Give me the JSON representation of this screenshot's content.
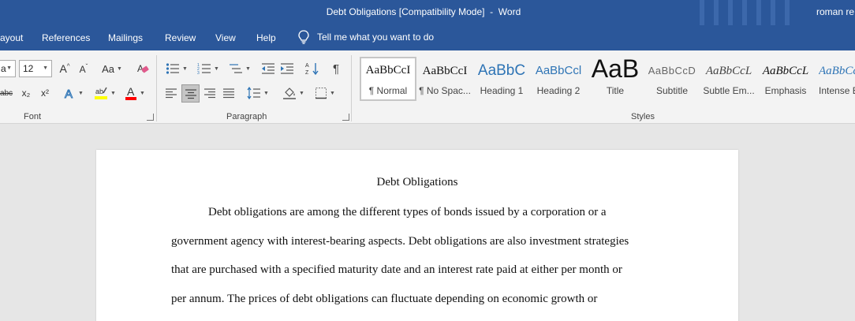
{
  "titlebar": {
    "title": "Debt Obligations [Compatibility Mode]  -  Word",
    "user": "roman re"
  },
  "menu": {
    "tabs": [
      "ayout",
      "References",
      "Mailings",
      "Review",
      "View",
      "Help"
    ],
    "tell_me": "Tell me what you want to do"
  },
  "ribbon": {
    "font": {
      "label": "Font",
      "font_name": "a",
      "font_size": "12",
      "change_case": "Aa",
      "strikethrough": "abc",
      "subscript": "x₂",
      "superscript": "x²"
    },
    "paragraph": {
      "label": "Paragraph"
    },
    "styles": {
      "label": "Styles",
      "items": [
        {
          "preview": "AaBbCcI",
          "name": "¶ Normal"
        },
        {
          "preview": "AaBbCcI",
          "name": "¶ No Spac..."
        },
        {
          "preview": "AaBbC",
          "name": "Heading 1"
        },
        {
          "preview": "AaBbCcl",
          "name": "Heading 2"
        },
        {
          "preview": "AaB",
          "name": "Title"
        },
        {
          "preview": "AaBbCcD",
          "name": "Subtitle"
        },
        {
          "preview": "AaBbCcL",
          "name": "Subtle Em..."
        },
        {
          "preview": "AaBbCcL",
          "name": "Emphasis"
        },
        {
          "preview": "AaBbCc",
          "name": "Intense E"
        }
      ]
    }
  },
  "document": {
    "title": "Debt Obligations",
    "lines": [
      "Debt obligations are among the different types of bonds issued by a corporation or a",
      "government agency with interest-bearing aspects. Debt obligations are also investment strategies",
      "that are purchased with a specified maturity date and an interest rate paid at either per month or",
      "per annum. The prices of debt obligations can fluctuate depending on economic growth or"
    ]
  },
  "colors": {
    "word_blue": "#2b579a",
    "highlight_yellow": "#ffff00",
    "font_color_red": "#ff0000",
    "heading_blue": "#2e74b5"
  }
}
